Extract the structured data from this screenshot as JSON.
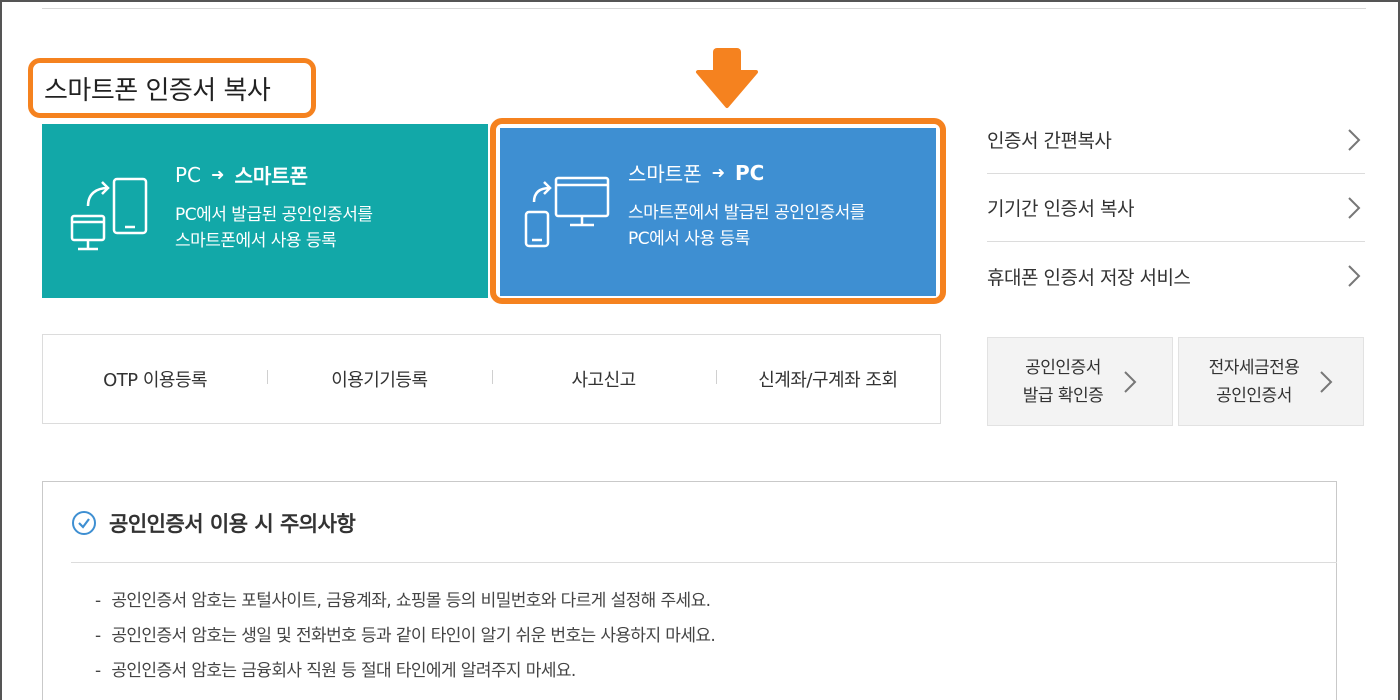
{
  "section_title": "스마트폰 인증서 복사",
  "card_pc_to_phone": {
    "from": "PC",
    "to": "스마트폰",
    "desc_line1": "PC에서 발급된 공인인증서를",
    "desc_line2": "스마트폰에서 사용 등록"
  },
  "card_phone_to_pc": {
    "from": "스마트폰",
    "to": "PC",
    "desc_line1": "스마트폰에서 발급된 공인인증서를",
    "desc_line2": "PC에서 사용 등록"
  },
  "right_links": [
    {
      "label": "인증서 간편복사"
    },
    {
      "label": "기기간 인증서 복사"
    },
    {
      "label": "휴대폰 인증서 저장 서비스"
    }
  ],
  "menu": [
    {
      "label": "OTP 이용등록"
    },
    {
      "label": "이용기기등록"
    },
    {
      "label": "사고신고"
    },
    {
      "label": "신계좌/구계좌 조회"
    }
  ],
  "gray_buttons": [
    {
      "line1": "공인인증서",
      "line2": "발급 확인증"
    },
    {
      "line1": "전자세금전용",
      "line2": "공인인증서"
    }
  ],
  "notice": {
    "title": "공인인증서 이용 시 주의사항",
    "items": [
      "공인인증서 암호는 포털사이트, 금융계좌, 쇼핑몰 등의 비밀번호와 다르게 설정해 주세요.",
      "공인인증서 암호는 생일 및 전화번호 등과 같이 타인이 알기 쉬운 번호는 사용하지 마세요.",
      "공인인증서 암호는 금융회사 직원 등 절대 타인에게 알려주지 마세요."
    ]
  },
  "colors": {
    "highlight": "#f5821f",
    "teal_card": "#12a8a8",
    "blue_card": "#3e8fd2",
    "notice_icon": "#3e8fd2"
  }
}
